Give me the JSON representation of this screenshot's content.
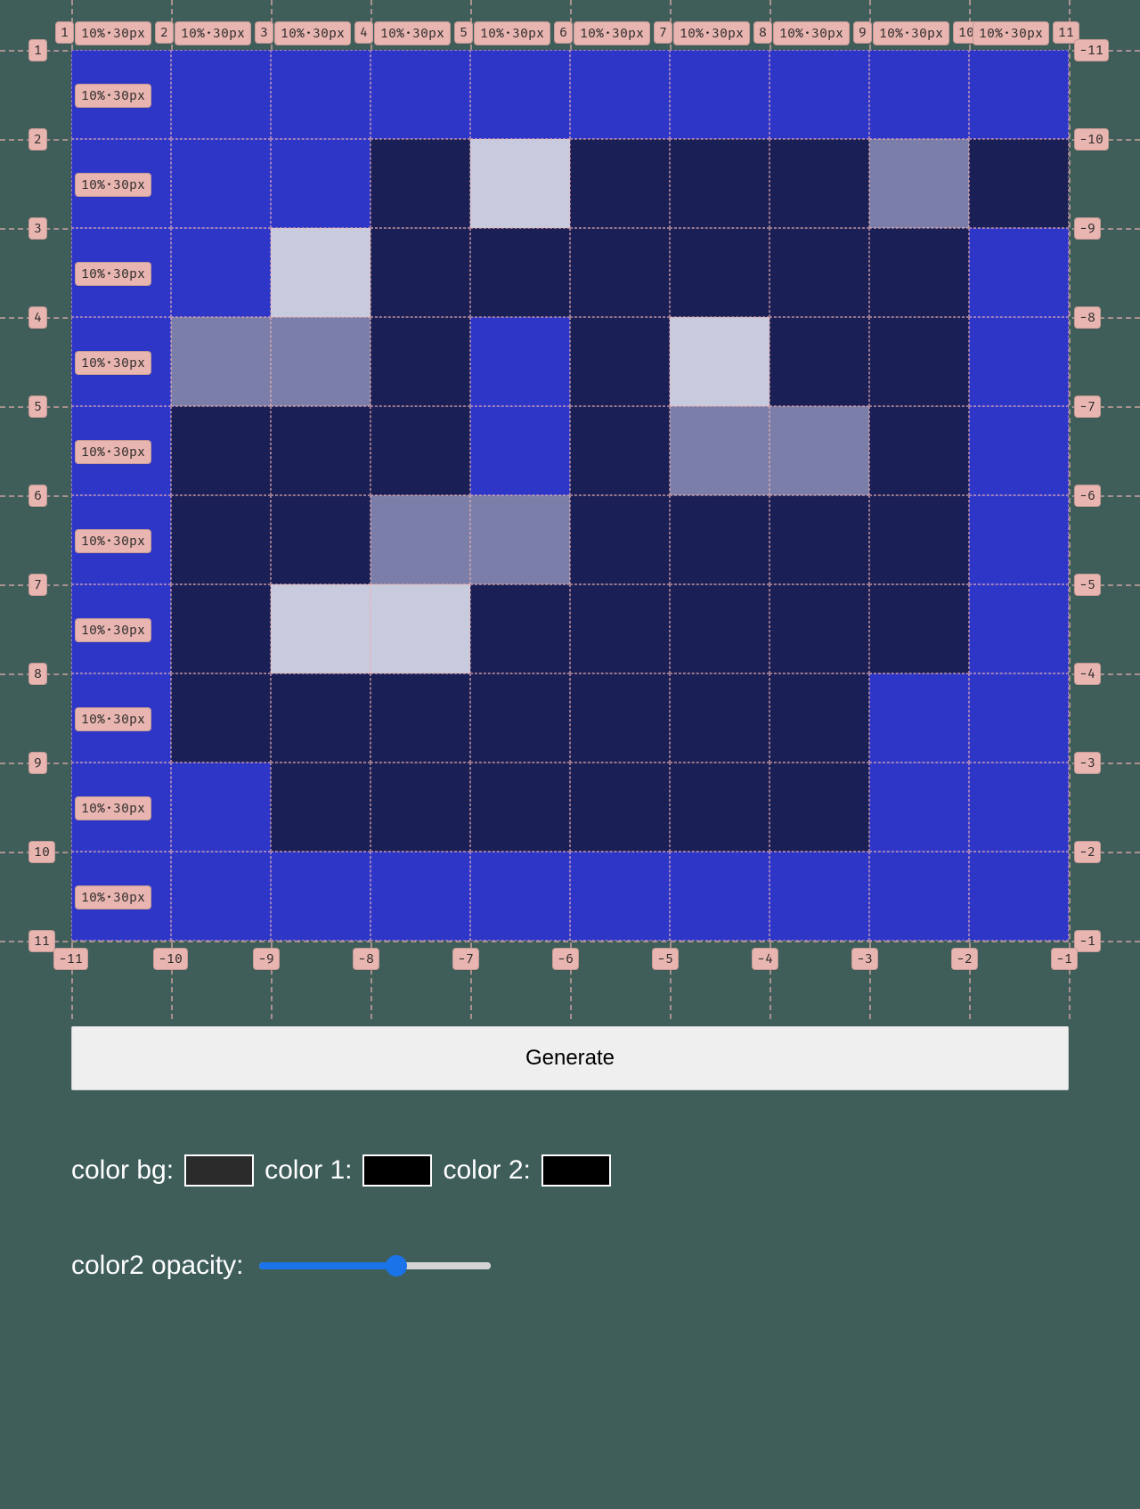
{
  "grid": {
    "rows": 10,
    "cols": 10,
    "track_label": "10%·30px",
    "top_line_numbers": [
      "1",
      "2",
      "3",
      "4",
      "5",
      "6",
      "7",
      "8",
      "9",
      "10",
      "11"
    ],
    "left_line_numbers": [
      "1",
      "2",
      "3",
      "4",
      "5",
      "6",
      "7",
      "8",
      "9",
      "10",
      "11"
    ],
    "right_line_numbers": [
      "-11",
      "-10",
      "-9",
      "-8",
      "-7",
      "-6",
      "-5",
      "-4",
      "-3",
      "-2",
      "-1"
    ],
    "bottom_line_numbers": [
      "-11",
      "-10",
      "-9",
      "-8",
      "-7",
      "-6",
      "-5",
      "-4",
      "-3",
      "-2",
      "-1"
    ],
    "bg_color": "#2e36c8",
    "cells": [
      [
        0,
        0,
        0,
        0,
        0,
        0,
        0,
        0,
        0,
        0
      ],
      [
        0,
        0,
        0,
        1,
        3,
        1,
        1,
        1,
        2,
        1
      ],
      [
        0,
        0,
        3,
        1,
        1,
        1,
        1,
        1,
        1,
        0
      ],
      [
        0,
        2,
        2,
        1,
        0,
        1,
        3,
        1,
        1,
        0
      ],
      [
        0,
        1,
        1,
        1,
        0,
        1,
        2,
        2,
        1,
        0
      ],
      [
        0,
        1,
        1,
        2,
        2,
        1,
        1,
        1,
        1,
        0
      ],
      [
        0,
        1,
        3,
        3,
        1,
        1,
        1,
        1,
        1,
        0
      ],
      [
        0,
        1,
        1,
        1,
        1,
        1,
        1,
        1,
        0,
        0
      ],
      [
        0,
        0,
        1,
        1,
        1,
        1,
        1,
        1,
        0,
        0
      ],
      [
        0,
        0,
        0,
        0,
        0,
        0,
        0,
        0,
        0,
        0
      ]
    ],
    "cell_colors": {
      "0": "#2e36c8",
      "1": "#1a1f55",
      "2": "#7a7ea8",
      "3": "#c8cade"
    }
  },
  "controls": {
    "generate_label": "Generate",
    "labels": {
      "bg": "color bg:",
      "c1": "color 1:",
      "c2": "color 2:",
      "opacity": "color2 opacity:"
    },
    "colors": {
      "bg": "#2b2b2b",
      "c1": "#000000",
      "c2": "#000000"
    },
    "opacity_percent": 60
  }
}
